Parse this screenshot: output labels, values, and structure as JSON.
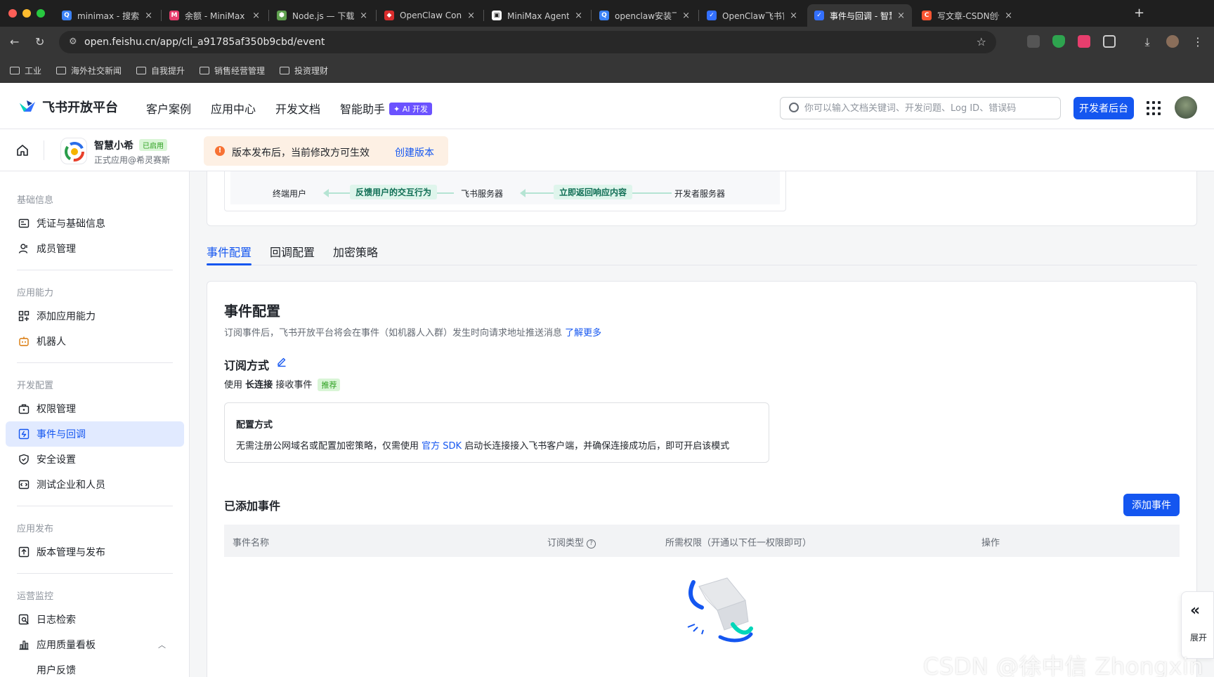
{
  "browser": {
    "tabs": [
      {
        "title": "minimax - 搜索",
        "fav_color": "#3b82f6",
        "fav_glyph": "Q",
        "active": false
      },
      {
        "title": "余额 - MiniMax 开",
        "fav_color": "#e63e6d",
        "fav_glyph": "M",
        "active": false
      },
      {
        "title": "Node.js — 下载 N",
        "fav_color": "#5fa04e",
        "fav_glyph": "⬢",
        "active": false
      },
      {
        "title": "OpenClaw Contr",
        "fav_color": "#d92c2c",
        "fav_glyph": "◆",
        "active": false
      },
      {
        "title": "MiniMax Agent: 加",
        "fav_color": "#ffffff",
        "fav_glyph": "▣",
        "active": false
      },
      {
        "title": "openclaw安装飞书",
        "fav_color": "#3b82f6",
        "fav_glyph": "Q",
        "active": false
      },
      {
        "title": "OpenClaw飞书官",
        "fav_color": "#3370ff",
        "fav_glyph": "✓",
        "active": false
      },
      {
        "title": "事件与回调 - 智慧",
        "fav_color": "#3370ff",
        "fav_glyph": "✓",
        "active": true
      },
      {
        "title": "写文章-CSDN创作",
        "fav_color": "#fc5531",
        "fav_glyph": "C",
        "active": false
      }
    ],
    "url": "open.feishu.cn/app/cli_a91785af350b9cbd/event",
    "bookmarks": [
      "工业",
      "海外社交新闻",
      "自我提升",
      "销售经营管理",
      "投资理财"
    ]
  },
  "topnav": {
    "brand": "飞书开放平台",
    "links": [
      "客户案例",
      "应用中心",
      "开发文档",
      "智能助手"
    ],
    "ai_badge": "✦ AI 开发",
    "search_placeholder": "你可以输入文档关键词、开发问题、Log ID、错误码",
    "dev_button": "开发者后台"
  },
  "app": {
    "name": "智慧小希",
    "status": "已启用",
    "subtitle": "正式应用@希灵赛斯",
    "notice": "版本发布后，当前修改方可生效",
    "notice_link": "创建版本"
  },
  "sidebar": {
    "groups": [
      {
        "title": "基础信息",
        "items": [
          {
            "label": "凭证与基础信息",
            "icon": "id-card-icon"
          },
          {
            "label": "成员管理",
            "icon": "user-icon"
          }
        ]
      },
      {
        "title": "应用能力",
        "items": [
          {
            "label": "添加应用能力",
            "icon": "apps-icon"
          },
          {
            "label": "机器人",
            "icon": "robot-icon"
          }
        ]
      },
      {
        "title": "开发配置",
        "items": [
          {
            "label": "权限管理",
            "icon": "briefcase-icon"
          },
          {
            "label": "事件与回调",
            "icon": "event-icon"
          },
          {
            "label": "安全设置",
            "icon": "shield-icon"
          },
          {
            "label": "测试企业和人员",
            "icon": "test-icon"
          }
        ]
      },
      {
        "title": "应用发布",
        "items": [
          {
            "label": "版本管理与发布",
            "icon": "upload-icon"
          }
        ]
      },
      {
        "title": "运营监控",
        "items": [
          {
            "label": "日志检索",
            "icon": "log-search-icon"
          },
          {
            "label": "应用质量看板",
            "icon": "bar-chart-icon"
          },
          {
            "label": "用户反馈",
            "icon": ""
          }
        ]
      }
    ],
    "active": "事件与回调"
  },
  "flow": {
    "end_user": "终端用户",
    "feishu_server": "飞书服务器",
    "dev_server": "开发者服务器",
    "arrow_left": "反馈用户的交互行为",
    "arrow_right": "立即返回响应内容"
  },
  "page_tabs": [
    "事件配置",
    "回调配置",
    "加密策略"
  ],
  "event_config": {
    "title": "事件配置",
    "desc": "订阅事件后，飞书开放平台将会在事件（如机器人入群）发生时向请求地址推送消息",
    "learn_more": "了解更多",
    "sub_title": "订阅方式",
    "sub_use": "使用",
    "sub_mode": "长连接",
    "sub_suffix": "接收事件",
    "recommend": "推荐",
    "cfg_title": "配置方式",
    "cfg_desc_pre": "无需注册公网域名或配置加密策略，仅需使用",
    "cfg_link": "官方 SDK",
    "cfg_desc_post": "启动长连接接入飞书客户端，并确保连接成功后，即可开启该模式",
    "added_title": "已添加事件",
    "add_button": "添加事件",
    "columns": [
      "事件名称",
      "订阅类型",
      "所需权限（开通以下任一权限即可）",
      "操作"
    ]
  },
  "expand": {
    "label": "展开"
  },
  "watermark": "CSDN @徐中信 Zhongxin Xu",
  "colors": {
    "accent": "#1456f0",
    "active_bg": "#e1eaff",
    "success": "#2ea121"
  }
}
